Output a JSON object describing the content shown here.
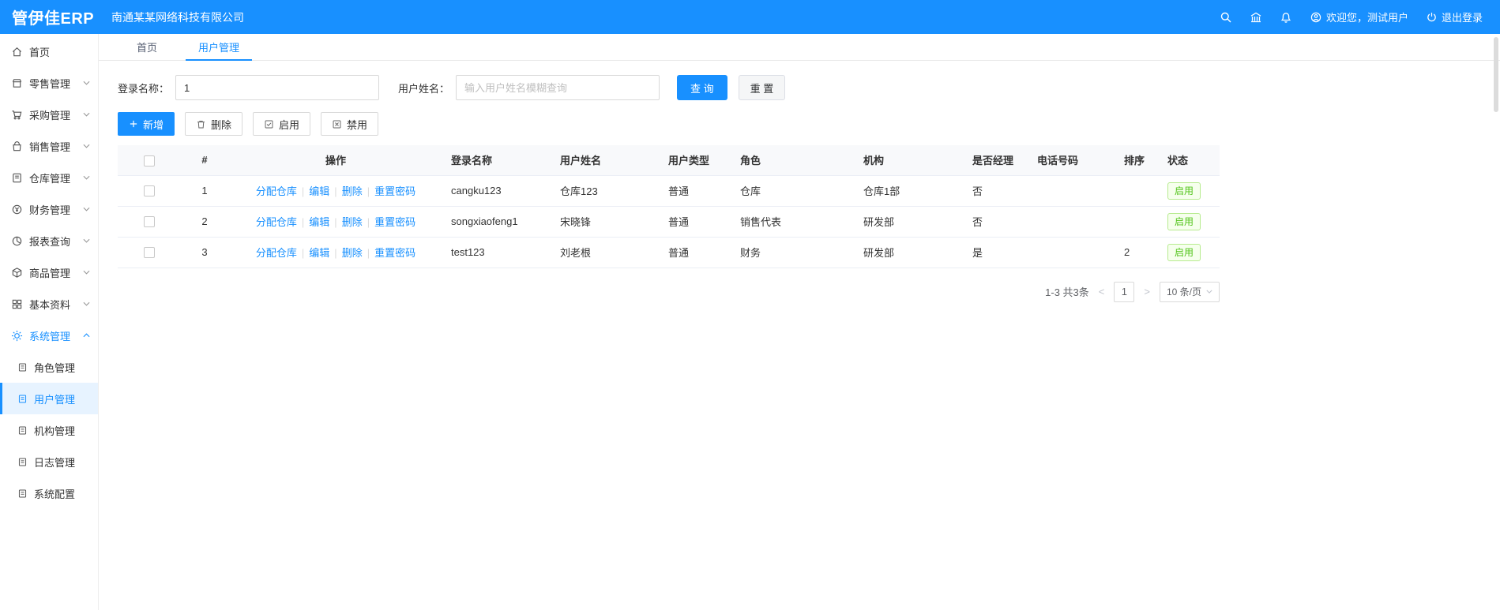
{
  "topbar": {
    "logo": "管伊佳ERP",
    "company": "南通某某网络科技有限公司",
    "welcome": "欢迎您，测试用户",
    "logout": "退出登录"
  },
  "sidebar": {
    "items": [
      {
        "label": "首页"
      },
      {
        "label": "零售管理"
      },
      {
        "label": "采购管理"
      },
      {
        "label": "销售管理"
      },
      {
        "label": "仓库管理"
      },
      {
        "label": "财务管理"
      },
      {
        "label": "报表查询"
      },
      {
        "label": "商品管理"
      },
      {
        "label": "基本资料"
      },
      {
        "label": "系统管理"
      }
    ],
    "submenu": [
      {
        "label": "角色管理"
      },
      {
        "label": "用户管理"
      },
      {
        "label": "机构管理"
      },
      {
        "label": "日志管理"
      },
      {
        "label": "系统配置"
      }
    ]
  },
  "tabs": {
    "home": "首页",
    "current": "用户管理"
  },
  "filters": {
    "login_label": "登录名称：",
    "login_value": "1",
    "name_label": "用户姓名：",
    "name_placeholder": "输入用户姓名模糊查询",
    "search_btn": "查 询",
    "reset_btn": "重 置"
  },
  "toolbar": {
    "add": "新增",
    "delete": "删除",
    "enable": "启用",
    "disable": "禁用"
  },
  "table": {
    "headers": {
      "index": "#",
      "actions": "操作",
      "login": "登录名称",
      "name": "用户姓名",
      "type": "用户类型",
      "role": "角色",
      "org": "机构",
      "manager": "是否经理",
      "phone": "电话号码",
      "sort": "排序",
      "status": "状态"
    },
    "action_links": {
      "assign": "分配仓库",
      "edit": "编辑",
      "del": "删除",
      "reset_pwd": "重置密码"
    },
    "rows": [
      {
        "index": "1",
        "login": "cangku123",
        "name": "仓库123",
        "type": "普通",
        "role": "仓库",
        "org": "仓库1部",
        "manager": "否",
        "phone": "",
        "sort": "",
        "status": "启用"
      },
      {
        "index": "2",
        "login": "songxiaofeng1",
        "name": "宋晓锋",
        "type": "普通",
        "role": "销售代表",
        "org": "研发部",
        "manager": "否",
        "phone": "",
        "sort": "",
        "status": "启用"
      },
      {
        "index": "3",
        "login": "test123",
        "name": "刘老根",
        "type": "普通",
        "role": "财务",
        "org": "研发部",
        "manager": "是",
        "phone": "",
        "sort": "2",
        "status": "启用"
      }
    ]
  },
  "pagination": {
    "total": "1-3 共3条",
    "page": "1",
    "size": "10 条/页"
  }
}
